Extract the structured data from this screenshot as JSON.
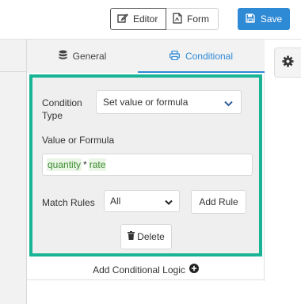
{
  "toolbar": {
    "editor_label": "Editor",
    "form_label": "Form",
    "save_label": "Save"
  },
  "tabs": {
    "general_label": "General",
    "conditional_label": "Conditional"
  },
  "conditional": {
    "condition_type_label": "Condition Type",
    "condition_type_value": "Set value or formula",
    "value_formula_label": "Value or Formula",
    "formula_tokens": [
      "quantity",
      "*",
      "rate"
    ],
    "match_rules_label": "Match Rules",
    "match_rules_value": "All",
    "add_rule_label": "Add Rule",
    "delete_label": "Delete"
  },
  "footer": {
    "add_conditional_logic_label": "Add Conditional Logic"
  },
  "icons": {
    "editor": "edit-icon",
    "form": "file-icon",
    "save": "floppy-disk-icon",
    "general": "database-icon",
    "conditional": "print-icon",
    "chevron": "chevron-down-icon",
    "delete": "trash-icon",
    "add": "plus-circle-icon",
    "settings": "gear-icon"
  },
  "colors": {
    "accent": "#2f8ad6",
    "highlight_border": "#19b496",
    "token_bg": "#eaf6e6",
    "token_text": "#3c8c32"
  }
}
